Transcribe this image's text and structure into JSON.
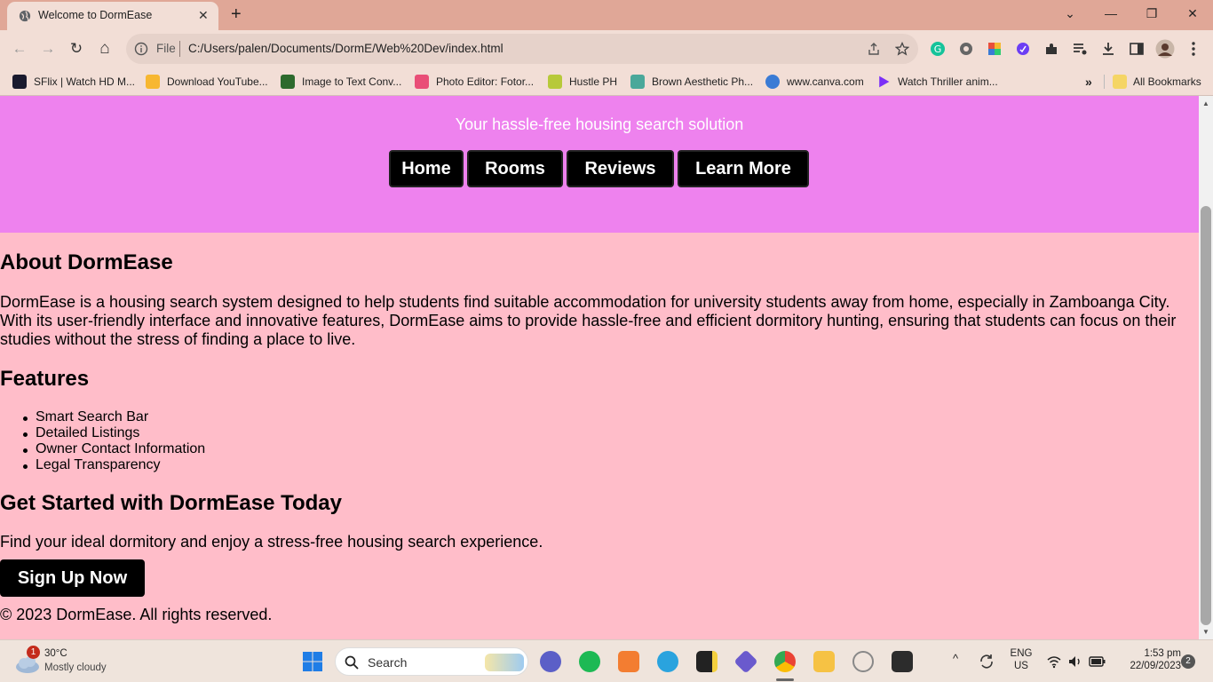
{
  "browser": {
    "tab": {
      "title": "Welcome to DormEase",
      "close": "✕"
    },
    "new_tab": "+",
    "window_controls": {
      "menu": "⌄",
      "minimize": "—",
      "restore": "❐",
      "close": "✕"
    },
    "nav": {
      "back": "←",
      "forward": "→",
      "reload": "↻",
      "home": "⌂"
    },
    "address": {
      "scheme": "File",
      "url": "C:/Users/palen/Documents/DormE/Web%20Dev/index.html"
    },
    "bookmarks": [
      {
        "label": "SFlix | Watch HD M...",
        "color": "#1a1a2e"
      },
      {
        "label": "Download YouTube...",
        "color": "#f7b731"
      },
      {
        "label": "Image to Text Conv...",
        "color": "#2d6a2d"
      },
      {
        "label": "Photo Editor: Fotor...",
        "color": "#e94e77"
      },
      {
        "label": "Hustle PH",
        "color": "#b7c93a"
      },
      {
        "label": "Brown Aesthetic Ph...",
        "color": "#4aa89a"
      },
      {
        "label": "www.canva.com",
        "color": "#3a7bd5"
      },
      {
        "label": "Watch Thriller anim...",
        "color": "#7b2ff7"
      }
    ],
    "bookmarks_overflow": "»",
    "all_bookmarks": "All Bookmarks"
  },
  "page": {
    "tagline": "Your hassle-free housing search solution",
    "nav": [
      "Home",
      "Rooms",
      "Reviews",
      "Learn More"
    ],
    "about": {
      "heading": "About DormEase",
      "body": "DormEase is a housing search system designed to help students find suitable accommodation for university students away from home, especially in Zamboanga City. With its user-friendly interface and innovative features, DormEase aims to provide hassle-free and efficient dormitory hunting, ensuring that students can focus on their studies without the stress of finding a place to live."
    },
    "features": {
      "heading": "Features",
      "items": [
        "Smart Search Bar",
        "Detailed Listings",
        "Owner Contact Information",
        "Legal Transparency"
      ]
    },
    "get_started": {
      "heading": "Get Started with DormEase Today",
      "body": "Find your ideal dormitory and enjoy a stress-free housing search experience.",
      "button": "Sign Up Now"
    },
    "footer": "© 2023 DormEase. All rights reserved."
  },
  "taskbar": {
    "weather": {
      "badge": "1",
      "temp": "30°C",
      "condition": "Mostly cloudy"
    },
    "search": "Search",
    "lang": {
      "line1": "ENG",
      "line2": "US"
    },
    "clock": {
      "time": "1:53 pm",
      "date": "22/09/2023"
    },
    "notifications": "2",
    "chevron": "^"
  }
}
